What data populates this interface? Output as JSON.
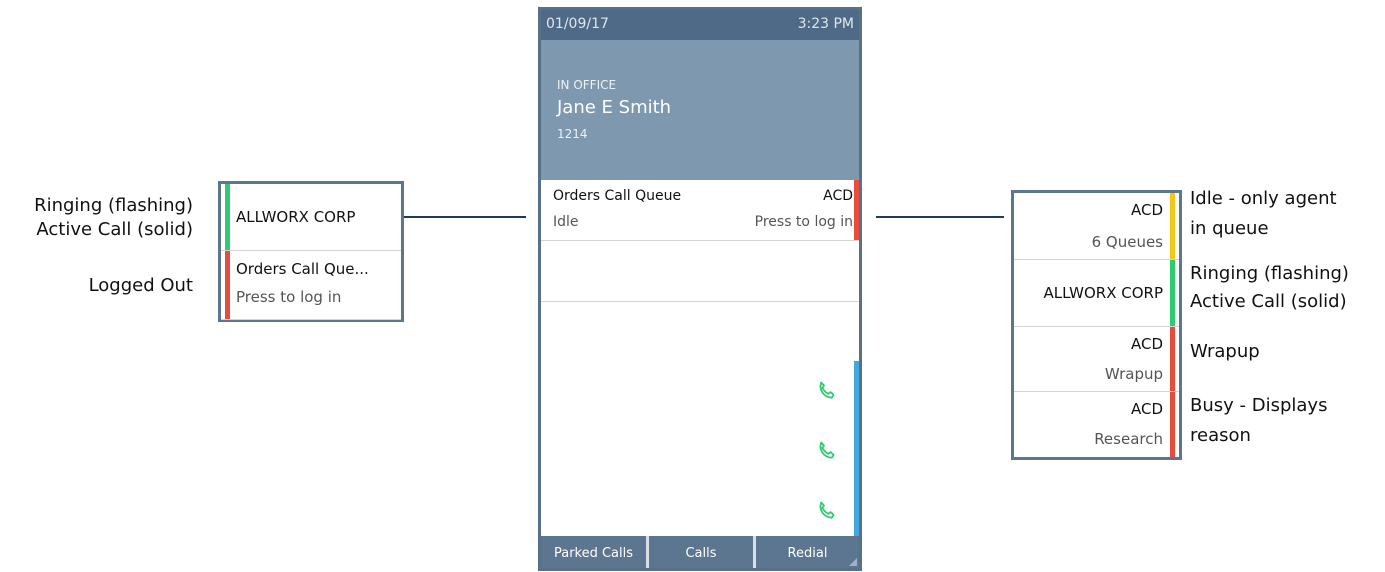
{
  "phone": {
    "date": "01/09/17",
    "time": "3:23 PM",
    "status": "IN OFFICE",
    "user_name": "Jane E Smith",
    "extension": "1214",
    "keys": [
      {
        "top_left": "Orders Call Queue",
        "top_right": "ACD",
        "bottom_left": "Idle",
        "bottom_right": "Press to log in",
        "indicator": "red"
      },
      {
        "top_left": "",
        "top_right": "",
        "bottom_left": "",
        "bottom_right": "",
        "indicator": ""
      },
      {
        "top_left": "",
        "top_right": "",
        "bottom_left": "",
        "bottom_right": "",
        "indicator": ""
      },
      {
        "icon": "phone-handset-icon",
        "indicator": "blue"
      },
      {
        "icon": "phone-handset-icon",
        "indicator": "blue"
      },
      {
        "icon": "phone-handset-icon",
        "indicator": "blue"
      }
    ],
    "softkeys": [
      "Parked Calls",
      "Calls",
      "Redial"
    ]
  },
  "left_panel": {
    "cells": [
      {
        "title": "ALLWORX CORP",
        "subtitle": "",
        "indicator": "green"
      },
      {
        "title": "Orders Call Que...",
        "subtitle": "Press to log in",
        "indicator": "red"
      }
    ],
    "labels": {
      "ringing": "Ringing (flashing)",
      "active": "Active Call (solid)",
      "logged_out": "Logged Out"
    }
  },
  "right_panel": {
    "cells": [
      {
        "title": "ACD",
        "subtitle": "6 Queues",
        "indicator": "yellow"
      },
      {
        "title": "ALLWORX CORP",
        "subtitle": "",
        "indicator": "green"
      },
      {
        "title": "ACD",
        "subtitle": "Wrapup",
        "indicator": "red"
      },
      {
        "title": "ACD",
        "subtitle": "Research",
        "indicator": "red"
      }
    ],
    "labels": {
      "idle_1": "Idle - only agent",
      "idle_2": "in queue",
      "ringing": "Ringing (flashing)",
      "active": "Active Call (solid)",
      "wrapup": "Wrapup",
      "busy_1": "Busy - Displays",
      "busy_2": "reason"
    }
  },
  "colors": {
    "green": "#2ecc71",
    "red": "#e74c3c",
    "yellow": "#f5c518",
    "blue": "#3fa9e0",
    "header": "#7e98af",
    "status_bar": "#4f6a87",
    "softkey": "#5d7690"
  }
}
